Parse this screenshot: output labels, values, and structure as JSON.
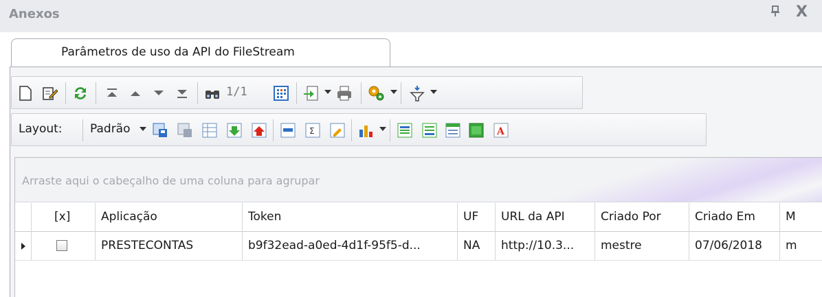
{
  "panel": {
    "title": "Anexos",
    "pin_glyph": "■",
    "close_glyph": "X"
  },
  "tab": {
    "label": "Parâmetros de uso da API do FileStream"
  },
  "toolbar1": {
    "record_counter": "1/1",
    "icons": [
      "new-document-icon",
      "edit-icon",
      "refresh-icon",
      "first-record-icon",
      "previous-record-icon",
      "next-record-icon",
      "last-record-icon",
      "find-icon",
      "grid-view-icon",
      "export-icon",
      "print-icon",
      "settings-gear-icon",
      "filter-icon"
    ]
  },
  "toolbar2": {
    "layout_label": "Layout:",
    "layout_value": "Padrão",
    "icons": [
      "save-layout-icon",
      "delete-layout-icon",
      "table-layout-icon",
      "import-layout-icon",
      "export-layout-icon",
      "column-chooser-icon",
      "summary-icon",
      "edit-grid-icon",
      "chart-icon",
      "group-view-icon",
      "footer-view-icon",
      "header-view-icon",
      "band-view-icon",
      "font-icon"
    ]
  },
  "grid": {
    "group_hint": "Arraste aqui o cabeçalho de uma coluna para agrupar",
    "columns": [
      "[x]",
      "Aplicação",
      "Token",
      "UF",
      "URL da API",
      "Criado Por",
      "Criado Em",
      "M"
    ],
    "rows": [
      {
        "checked": false,
        "aplicacao": "PRESTECONTAS",
        "token": "b9f32ead-a0ed-4d1f-95f5-d...",
        "uf": "NA",
        "url": "http://10.3...",
        "criado_por": "mestre",
        "criado_em": "07/06/2018",
        "m": "m"
      }
    ]
  },
  "colors": {
    "panel_header_bg": "#e9ebee",
    "panel_title": "#8e9196",
    "refresh_green": "#2f9e2f",
    "accent_blue": "#2d6fc4"
  }
}
